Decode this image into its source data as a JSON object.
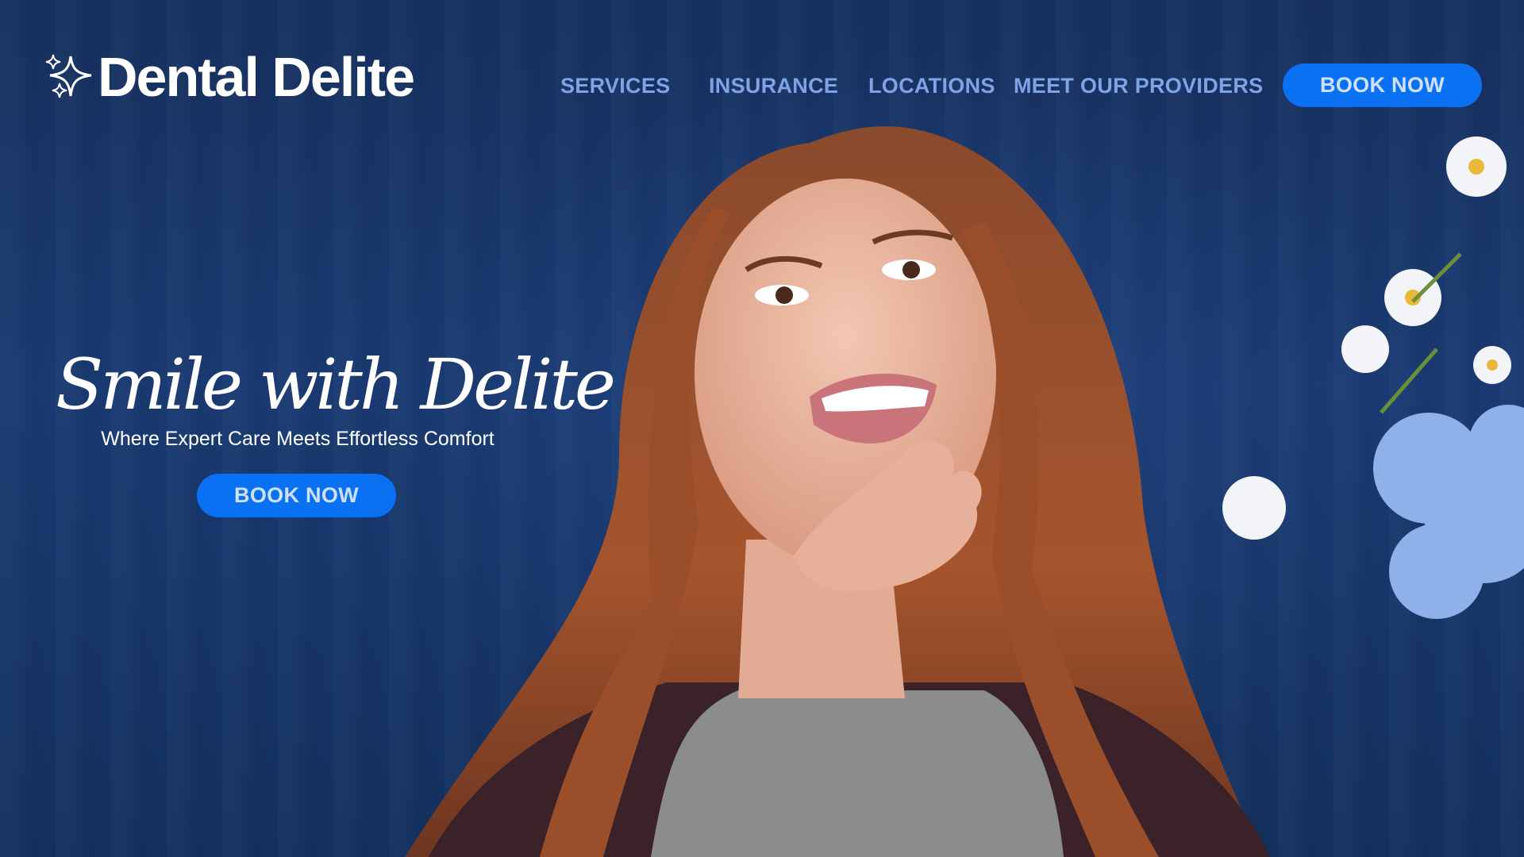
{
  "brand": {
    "name": "Dental Delite",
    "logo_icon": "sparkle-stars-icon"
  },
  "nav": {
    "items": [
      {
        "label": "SERVICES"
      },
      {
        "label": "INSURANCE"
      },
      {
        "label": "LOCATIONS"
      },
      {
        "label": "MEET OUR PROVIDERS"
      }
    ],
    "book_label": "BOOK NOW"
  },
  "hero": {
    "title": "Smile with Delite",
    "subtitle": "Where Expert Care Meets Effortless Comfort",
    "cta_label": "BOOK NOW"
  },
  "colors": {
    "background": "#15305f",
    "accent": "#0a72f2",
    "nav_text": "#7fa3e6",
    "button_text": "#cfe0fb",
    "heading_text": "#ffffff"
  }
}
